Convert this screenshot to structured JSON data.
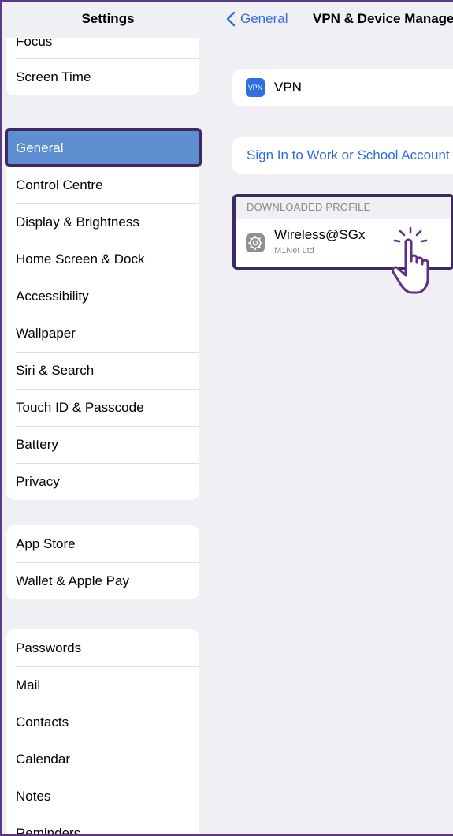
{
  "sidebar": {
    "title": "Settings",
    "group1": [
      "Focus",
      "Screen Time"
    ],
    "selected": "General",
    "group2": [
      "Control Centre",
      "Display & Brightness",
      "Home Screen & Dock",
      "Accessibility",
      "Wallpaper",
      "Siri & Search",
      "Touch ID & Passcode",
      "Battery",
      "Privacy"
    ],
    "group3": [
      "App Store",
      "Wallet & Apple Pay"
    ],
    "group4": [
      "Passwords",
      "Mail",
      "Contacts",
      "Calendar",
      "Notes",
      "Reminders"
    ]
  },
  "detail": {
    "back_label": "General",
    "title": "VPN & Device Management",
    "vpn_icon_text": "VPN",
    "vpn_label": "VPN",
    "signin_label": "Sign In to Work or School Account",
    "section_header": "DOWNLOADED PROFILE",
    "profile": {
      "name": "Wireless@SGx",
      "org": "M1Net Ltd"
    }
  },
  "colors": {
    "accent_blue": "#2f6ee0",
    "selected_row": "#5f8fd0",
    "highlight_border": "#3d2a63",
    "background": "#efeff4"
  },
  "icons": {
    "back": "chevron-left-icon",
    "profile": "settings-gear-icon",
    "tap": "tap-hand-icon"
  }
}
